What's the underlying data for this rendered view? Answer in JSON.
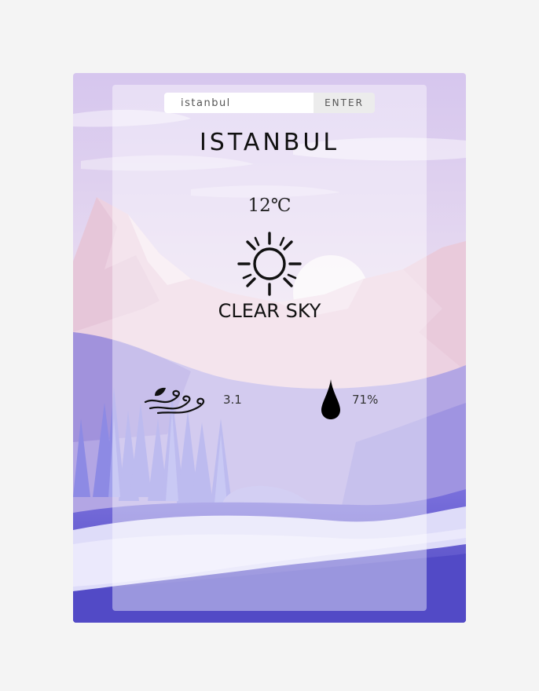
{
  "search": {
    "value": "istanbul",
    "button_label": "ENTER"
  },
  "weather": {
    "city": "ISTANBUL",
    "temperature": "12℃",
    "condition_icon": "sun-icon",
    "description": "CLEAR SKY",
    "wind_icon": "wind-icon",
    "wind_speed": "3.1",
    "humidity_icon": "droplet-icon",
    "humidity": "71%"
  },
  "colors": {
    "page_background": "#f4f4f4",
    "panel_overlay": "rgba(255,255,255,0.42)",
    "sky_top": "#d7c7ee",
    "sky_bottom": "#f3e4ee",
    "mountains": "#ebcfe0",
    "hills": "#a79ce0",
    "trees": "#8c8ae0",
    "river": "#dcdcf9",
    "ground": "#5a52c8",
    "text": "#111111"
  }
}
